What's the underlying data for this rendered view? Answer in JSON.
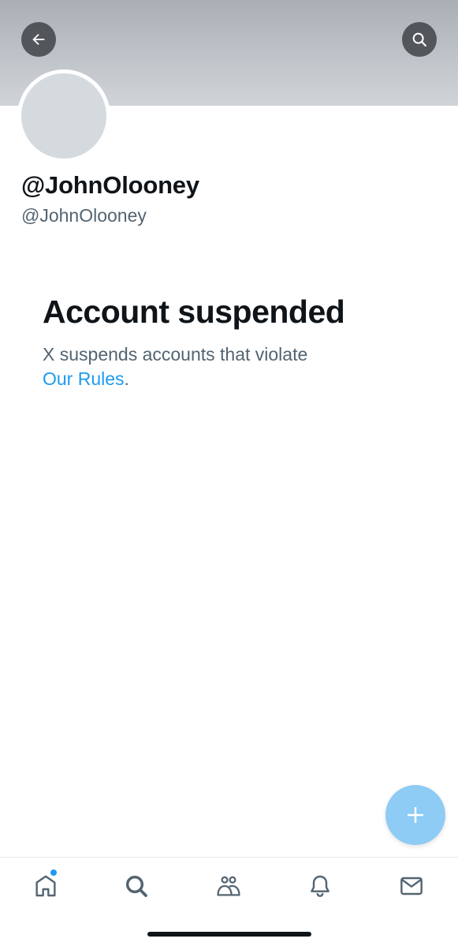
{
  "header": {
    "back_icon": "arrow-left-icon",
    "search_icon": "search-icon",
    "banner_color": "#bfc4c9"
  },
  "profile": {
    "display_name": "@JohnOlooney",
    "handle": "@JohnOlooney"
  },
  "notice": {
    "title": "Account suspended",
    "body": "X suspends accounts that violate",
    "link_label": "Our Rules",
    "trailing": "."
  },
  "fab": {
    "icon": "plus-icon",
    "color": "#8ecbf5"
  },
  "tabbar": {
    "items": [
      {
        "icon": "home-icon",
        "has_unread_dot": true
      },
      {
        "icon": "search-icon"
      },
      {
        "icon": "communities-icon"
      },
      {
        "icon": "bell-icon"
      },
      {
        "icon": "mail-icon"
      }
    ]
  },
  "colors": {
    "accent": "#1d9bf0",
    "text_primary": "#0f1419",
    "text_secondary": "#536471"
  }
}
